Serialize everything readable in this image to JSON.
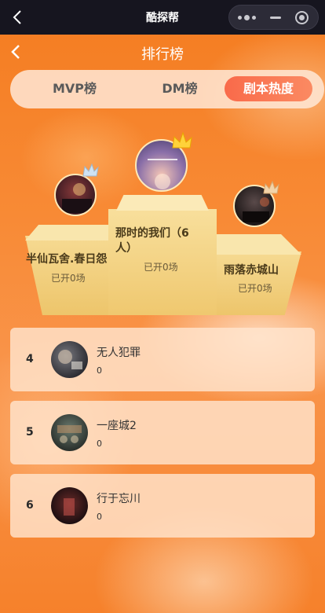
{
  "wechat_bar": {
    "title": "酷探帮"
  },
  "header": {
    "title": "排行榜"
  },
  "tabs": [
    {
      "label": "MVP榜",
      "active": false
    },
    {
      "label": "DM榜",
      "active": false
    },
    {
      "label": "剧本热度",
      "active": true
    }
  ],
  "podium": {
    "first": {
      "name": "那时的我们（6人）",
      "count": "已开0场",
      "avatar_text": "那时的我们"
    },
    "second": {
      "name": "半仙瓦舍.春日怨",
      "count": "已开0场",
      "avatar_text": "春日怨"
    },
    "third": {
      "name": "雨落赤城山",
      "count": "已开0场",
      "avatar_text": "雨落赤城山"
    }
  },
  "list": [
    {
      "rank": "4",
      "name": "无人犯罪",
      "count": "0",
      "avatar_text": "无人犯罪"
    },
    {
      "rank": "5",
      "name": "一座城2",
      "count": "0"
    },
    {
      "rank": "6",
      "name": "行于忘川",
      "count": "0",
      "avatar_text": "行于忘川"
    }
  ],
  "colors": {
    "background": "#f6893a",
    "active_tab": "#f96a4a",
    "podium": "#f6da92",
    "card": "#ffe4cd"
  }
}
